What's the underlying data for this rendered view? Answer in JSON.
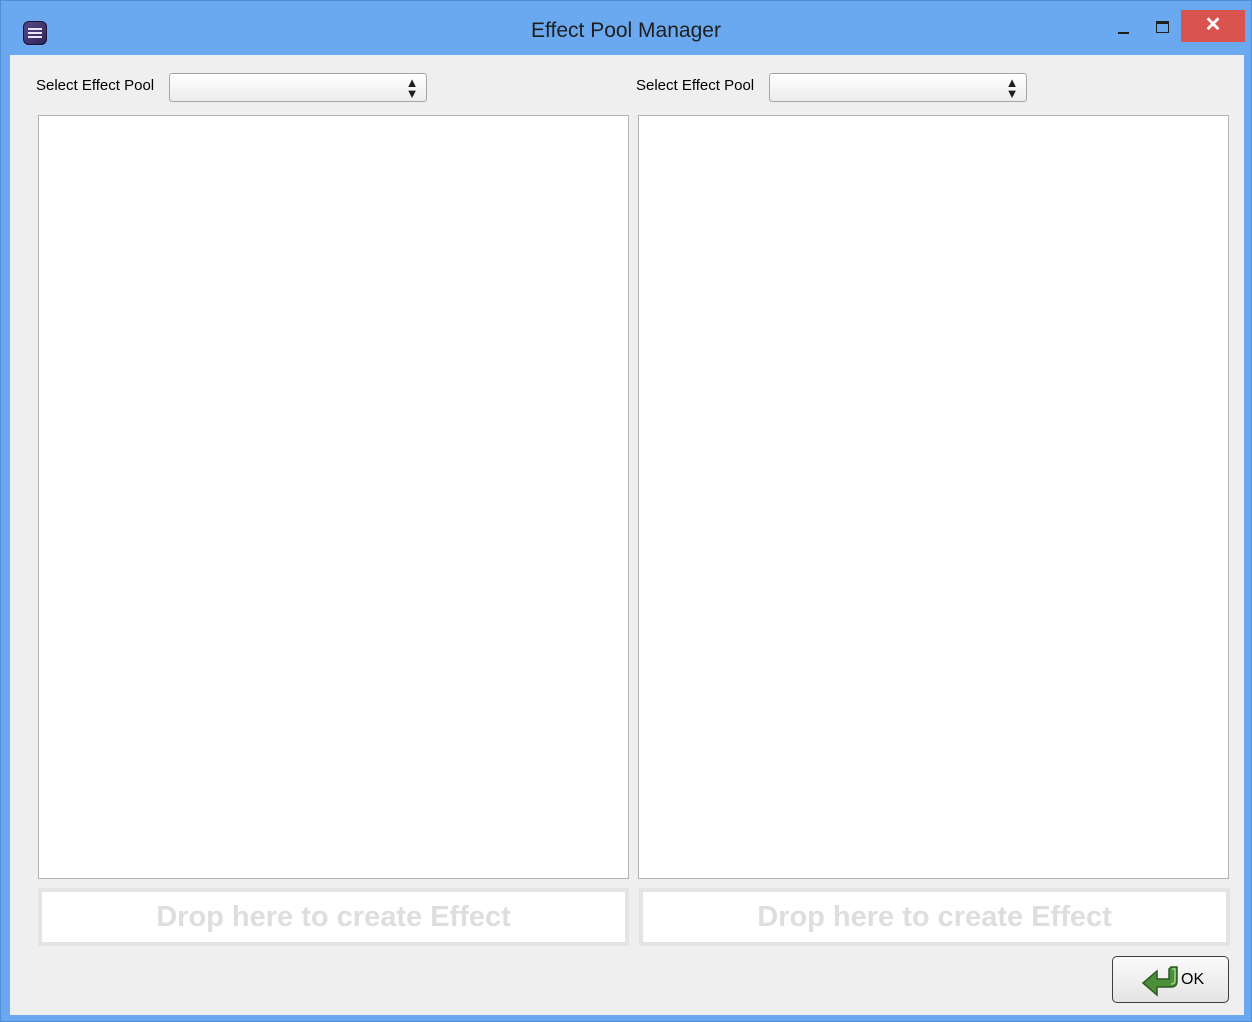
{
  "window": {
    "title": "Effect Pool Manager",
    "close_glyph": "✕",
    "icon": "app-icon"
  },
  "left_pool": {
    "label": "Select Effect Pool",
    "selected_value": "",
    "drop_zone_text": "Drop here to create Effect"
  },
  "right_pool": {
    "label": "Select Effect Pool",
    "selected_value": "",
    "drop_zone_text": "Drop here to create Effect"
  },
  "select_arrow_glyph": "▲\n▼",
  "ok_button": {
    "label": "OK",
    "icon": "return-arrow-icon"
  },
  "colors": {
    "titlebar": "#6aa8ef",
    "close_button": "#d9534f",
    "client_background": "#efefef",
    "ok_icon_green": "#3f7f2f"
  }
}
